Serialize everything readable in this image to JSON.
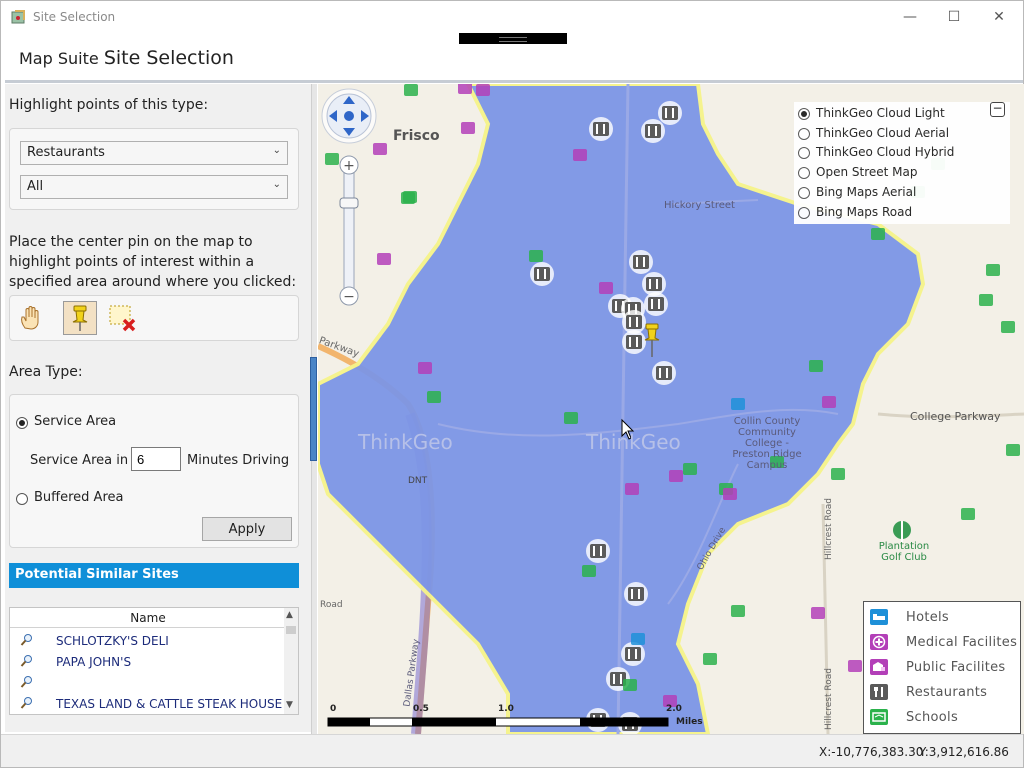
{
  "window": {
    "title": "Site Selection",
    "minimize": "—",
    "maximize": "☐",
    "close": "✕"
  },
  "header": {
    "brand": "Map Suite",
    "title": "Site Selection"
  },
  "sidebar": {
    "highlight_label": "Highlight points of this type:",
    "type_select": "Restaurants",
    "subtype_select": "All",
    "instructions": "Place the center pin on the map to highlight points of interest within a specified area around where you clicked:",
    "tools": [
      "hand-pan-icon",
      "pushpin-icon",
      "clear-selection-icon"
    ],
    "area_type_label": "Area Type:",
    "service_area_label": "Service Area",
    "service_area_in_label": "Service Area in",
    "service_area_minutes": "6",
    "minutes_driving_label": "Minutes Driving",
    "buffered_area_label": "Buffered Area",
    "apply_label": "Apply",
    "service_area_selected": true
  },
  "results": {
    "section_title": "Potential Similar Sites",
    "column_header": "Name",
    "rows": [
      "SCHLOTZKY'S DELI",
      "PAPA JOHN'S",
      "",
      "TEXAS LAND & CATTLE STEAK HOUSE"
    ]
  },
  "map": {
    "place_labels": {
      "frisco": "Frisco",
      "hickory": "Hickory Street",
      "parkway": "Parkway",
      "college_parkway": "College Parkway",
      "collin": "Collin County Community College - Preston Ridge Campus",
      "dnt": "DNT",
      "plantation": "Plantation Golf Club",
      "ohio": "Ohio Drive",
      "hillcrest": "Hillcrest Road",
      "dallas_parkway": "Dallas Parkway",
      "road": "Road",
      "watermark1": "ThinkGeo",
      "watermark2": "ThinkGeo"
    },
    "layers": [
      {
        "label": "ThinkGeo Cloud Light",
        "selected": true
      },
      {
        "label": "ThinkGeo Cloud Aerial",
        "selected": false
      },
      {
        "label": "ThinkGeo Cloud Hybrid",
        "selected": false
      },
      {
        "label": "Open Street Map",
        "selected": false
      },
      {
        "label": "Bing Maps Aerial",
        "selected": false
      },
      {
        "label": "Bing Maps Road",
        "selected": false
      }
    ],
    "collapse_label": "−",
    "legend": [
      {
        "label": "Hotels",
        "icon": "hotel-icon",
        "color": "#1e90d8"
      },
      {
        "label": "Medical Facilites",
        "icon": "medical-icon",
        "color": "#b33fb8"
      },
      {
        "label": "Public Facilites",
        "icon": "public-facility-icon",
        "color": "#b33fb8"
      },
      {
        "label": "Restaurants",
        "icon": "restaurant-icon",
        "color": "#5a5a5a"
      },
      {
        "label": "Schools",
        "icon": "school-icon",
        "color": "#2bb24c"
      }
    ],
    "scale": {
      "ticks": [
        "0",
        "0.5",
        "1.0",
        "2.0"
      ],
      "unit": "Miles"
    },
    "service_area_color": "#7d96e6"
  },
  "status": {
    "x": "X:-10,776,383.30",
    "y": "Y:3,912,616.86"
  }
}
